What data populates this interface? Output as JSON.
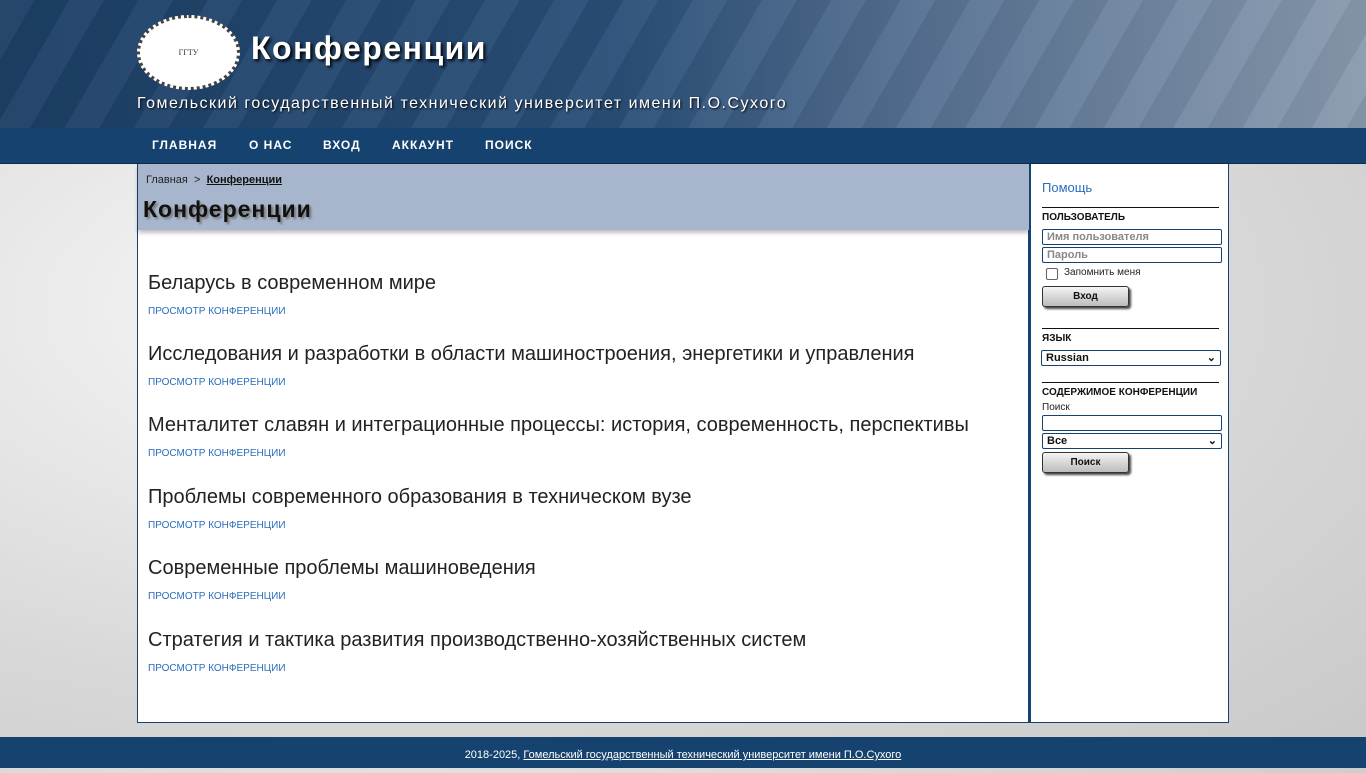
{
  "header": {
    "title": "Конференции",
    "subtitle": "Гомельский государственный технический университет имени П.О.Сухого",
    "logo_text": "ГГТУ"
  },
  "nav": [
    "ГЛАВНАЯ",
    "О НАС",
    "ВХОД",
    "АККАУНТ",
    "ПОИСК"
  ],
  "breadcrumb": {
    "home": "Главная",
    "sep": ">",
    "current": "Конференции"
  },
  "page_title": "Конференции",
  "conferences": [
    {
      "title": "Беларусь в современном мире",
      "link": "ПРОСМОТР КОНФЕРЕНЦИИ"
    },
    {
      "title": "Исследования и разработки в области машиностроения, энергетики и управления",
      "link": "ПРОСМОТР КОНФЕРЕНЦИИ"
    },
    {
      "title": "Менталитет славян и интеграционные процессы: история, современность, перспективы",
      "link": "ПРОСМОТР КОНФЕРЕНЦИИ"
    },
    {
      "title": "Проблемы современного образования в техническом вузе",
      "link": "ПРОСМОТР КОНФЕРЕНЦИИ"
    },
    {
      "title": "Современные проблемы машиноведения",
      "link": "ПРОСМОТР КОНФЕРЕНЦИИ"
    },
    {
      "title": "Стратегия и тактика развития производственно-хозяйственных систем",
      "link": "ПРОСМОТР КОНФЕРЕНЦИИ"
    }
  ],
  "sidebar": {
    "help": "Помощь",
    "user": {
      "heading": "ПОЛЬЗОВАТЕЛЬ",
      "username_placeholder": "Имя пользователя",
      "password_placeholder": "Пароль",
      "remember": "Запомнить меня",
      "login": "Вход"
    },
    "language": {
      "heading": "ЯЗЫК",
      "selected": "Russian"
    },
    "content": {
      "heading": "СОДЕРЖИМОЕ КОНФЕРЕНЦИИ",
      "search_label": "Поиск",
      "search_value": "",
      "scope": "Все",
      "search_button": "Поиск"
    }
  },
  "footer": {
    "years": "2018-2025,",
    "link": "Гомельский государственный технический университет имени П.О.Сухого"
  }
}
